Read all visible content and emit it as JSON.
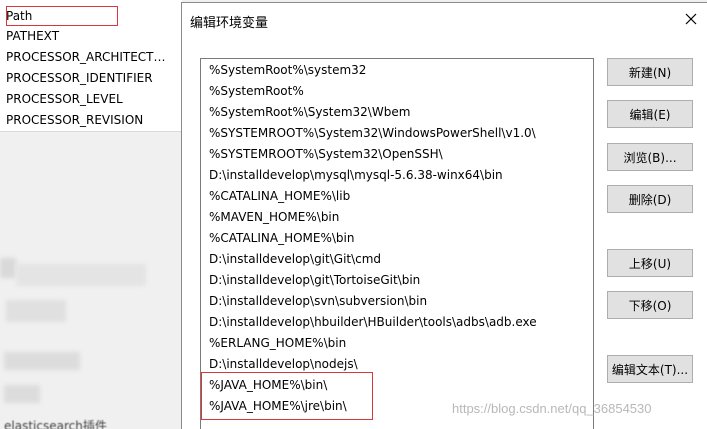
{
  "background": {
    "env_vars": [
      "Path",
      "PATHEXT",
      "PROCESSOR_ARCHITECT…",
      "PROCESSOR_IDENTIFIER",
      "PROCESSOR_LEVEL",
      "PROCESSOR_REVISION"
    ],
    "partial_text": "elasticsearch插件"
  },
  "dialog": {
    "title": "编辑环境变量",
    "paths": [
      "%SystemRoot%\\system32",
      "%SystemRoot%",
      "%SystemRoot%\\System32\\Wbem",
      "%SYSTEMROOT%\\System32\\WindowsPowerShell\\v1.0\\",
      "%SYSTEMROOT%\\System32\\OpenSSH\\",
      "D:\\installdevelop\\mysql\\mysql-5.6.38-winx64\\bin",
      "%CATALINA_HOME%\\lib",
      "%MAVEN_HOME%\\bin",
      "%CATALINA_HOME%\\bin",
      "D:\\installdevelop\\git\\Git\\cmd",
      "D:\\installdevelop\\git\\TortoiseGit\\bin",
      "D:\\installdevelop\\svn\\subversion\\bin",
      "D:\\installdevelop\\hbuilder\\HBuilder\\tools\\adbs\\adb.exe",
      "%ERLANG_HOME%\\bin",
      "D:\\installdevelop\\nodejs\\",
      "%JAVA_HOME%\\bin\\",
      "%JAVA_HOME%\\jre\\bin\\"
    ],
    "buttons": {
      "new": "新建(N)",
      "edit": "编辑(E)",
      "browse": "浏览(B)...",
      "delete": "删除(D)",
      "move_up": "上移(U)",
      "move_down": "下移(O)",
      "edit_text": "编辑文本(T)..."
    }
  },
  "watermark": "https://blog.csdn.net/qq_36854530",
  "colors": {
    "highlight": "#d9383a"
  }
}
